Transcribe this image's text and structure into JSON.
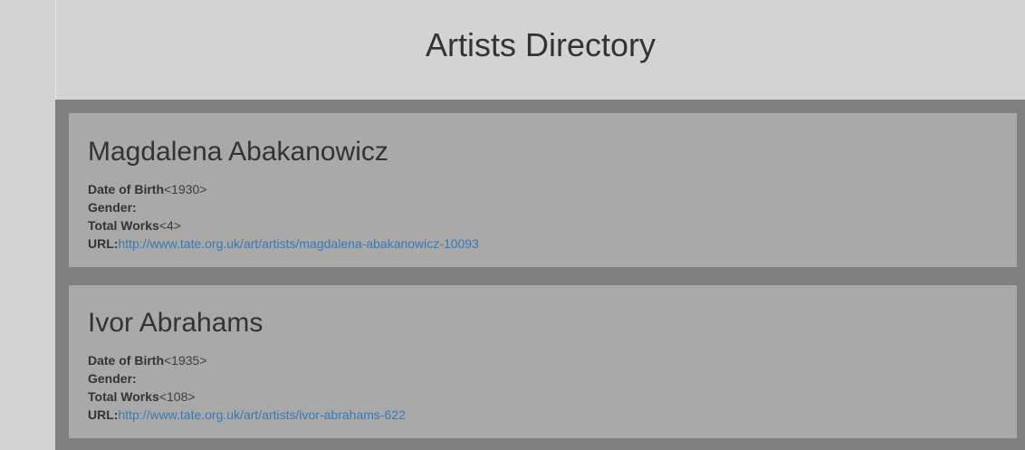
{
  "header": {
    "title": "Artists Directory"
  },
  "labels": {
    "dob": "Date of Birth",
    "gender": "Gender:",
    "total_works": "Total Works",
    "url": "URL:"
  },
  "artists": [
    {
      "name": "Magdalena Abakanowicz",
      "dob": "<1930>",
      "gender": "",
      "total_works": "<4>",
      "url": "http://www.tate.org.uk/art/artists/magdalena-abakanowicz-10093"
    },
    {
      "name": "Ivor Abrahams",
      "dob": "<1935>",
      "gender": "",
      "total_works": "<108>",
      "url": "http://www.tate.org.uk/art/artists/ivor-abrahams-622"
    }
  ],
  "colors": {
    "page_bg": "#d3d3d3",
    "content_bg": "#808080",
    "card_bg": "#a9a9a9",
    "link": "#337ab7"
  }
}
